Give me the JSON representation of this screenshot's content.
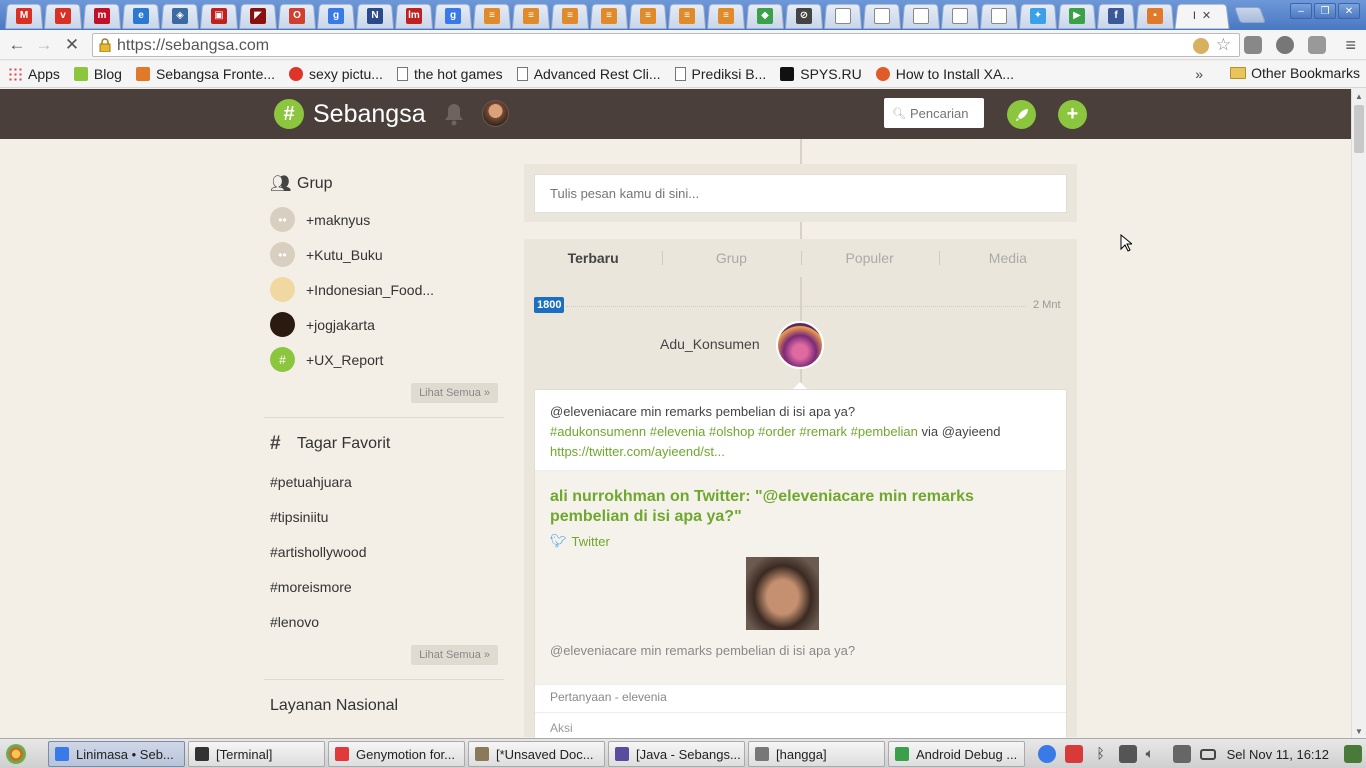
{
  "browser": {
    "tabs": [
      {
        "icon": "gmail-icon",
        "color": "#d93025",
        "glyph": "M"
      },
      {
        "icon": "vivo-icon",
        "color": "#d93025",
        "glyph": "v"
      },
      {
        "icon": "m-icon",
        "color": "#c0102a",
        "glyph": "m"
      },
      {
        "icon": "ie-icon",
        "color": "#2a78d0",
        "glyph": "e"
      },
      {
        "icon": "fox-icon",
        "color": "#3a6aa0",
        "glyph": "◈"
      },
      {
        "icon": "red-icon",
        "color": "#c02020",
        "glyph": "▣"
      },
      {
        "icon": "dark-red-icon",
        "color": "#8a1010",
        "glyph": "◤"
      },
      {
        "icon": "opera-icon",
        "color": "#d04030",
        "glyph": "O"
      },
      {
        "icon": "google-icon",
        "color": "#3a7ae8",
        "glyph": "g"
      },
      {
        "icon": "news-icon",
        "color": "#2a4a8a",
        "glyph": "N"
      },
      {
        "icon": "lm-icon",
        "color": "#c02020",
        "glyph": "lm"
      },
      {
        "icon": "google-icon",
        "color": "#3a7ae8",
        "glyph": "g"
      },
      {
        "icon": "stack-icon",
        "color": "#e08a2a",
        "glyph": "≡"
      },
      {
        "icon": "stack-icon",
        "color": "#e08a2a",
        "glyph": "≡"
      },
      {
        "icon": "stack-icon",
        "color": "#e08a2a",
        "glyph": "≡"
      },
      {
        "icon": "stack-icon",
        "color": "#e08a2a",
        "glyph": "≡"
      },
      {
        "icon": "stack-icon",
        "color": "#e08a2a",
        "glyph": "≡"
      },
      {
        "icon": "stack-icon",
        "color": "#e08a2a",
        "glyph": "≡"
      },
      {
        "icon": "stack-icon",
        "color": "#e08a2a",
        "glyph": "≡"
      },
      {
        "icon": "maps-icon",
        "color": "#3aa04a",
        "glyph": "◆"
      },
      {
        "icon": "compass-icon",
        "color": "#444444",
        "glyph": "⊘"
      },
      {
        "icon": "doc-icon",
        "color": "#ffffff",
        "glyph": ""
      },
      {
        "icon": "doc-icon",
        "color": "#ffffff",
        "glyph": ""
      },
      {
        "icon": "doc-icon",
        "color": "#ffffff",
        "glyph": ""
      },
      {
        "icon": "doc-icon",
        "color": "#ffffff",
        "glyph": ""
      },
      {
        "icon": "doc-icon",
        "color": "#ffffff",
        "glyph": ""
      },
      {
        "icon": "twitter-icon",
        "color": "#3aa0e8",
        "glyph": "✦"
      },
      {
        "icon": "play-icon",
        "color": "#3aa04a",
        "glyph": "▶"
      },
      {
        "icon": "facebook-icon",
        "color": "#3b5998",
        "glyph": "f"
      },
      {
        "icon": "flag-icon",
        "color": "#e07a2a",
        "glyph": "▪"
      }
    ],
    "active_tab_label": "I",
    "url": "https://sebangsa.com",
    "bookmarks": [
      {
        "label": "Apps",
        "icon": "apps-grid-icon",
        "color": ""
      },
      {
        "label": "Blog",
        "icon": "blog-icon",
        "color": "#8cc63f"
      },
      {
        "label": "Sebangsa Fronte...",
        "icon": "sebangsa-icon",
        "color": "#e07a2a"
      },
      {
        "label": "sexy pictu...",
        "icon": "heart-icon",
        "color": "#e0332a"
      },
      {
        "label": "the hot games",
        "icon": "page-icon",
        "color": ""
      },
      {
        "label": "Advanced Rest Cli...",
        "icon": "page-icon",
        "color": ""
      },
      {
        "label": "Prediksi B...",
        "icon": "page-icon",
        "color": ""
      },
      {
        "label": "SPYS.RU",
        "icon": "spys-icon",
        "color": "#111111"
      },
      {
        "label": "How to Install XA...",
        "icon": "upload-icon",
        "color": "#e05a2a"
      }
    ],
    "overflow_label": "»",
    "other_bookmarks": "Other Bookmarks"
  },
  "header": {
    "brand": "Sebangsa",
    "search_placeholder": "Pencarian",
    "accent": "#8cc63f",
    "bg": "#4a3f3a"
  },
  "sidebar": {
    "groups_title": "Grup",
    "groups": [
      {
        "name": "+maknyus",
        "color": "#d8cfc0"
      },
      {
        "name": "+Kutu_Buku",
        "color": "#d8cfc0"
      },
      {
        "name": "+Indonesian_Food...",
        "color": "#f0d8a0"
      },
      {
        "name": "+jogjakarta",
        "color": "#2a1a10"
      },
      {
        "name": "+UX_Report",
        "color": "#8cc63f"
      }
    ],
    "groups_more": "Lihat Semua »",
    "tags_title": "Tagar Favorit",
    "tags": [
      "#petuahjuara",
      "#tipsiniitu",
      "#artishollywood",
      "#moreismore",
      "#lenovo"
    ],
    "tags_more": "Lihat Semua »",
    "national_title": "Layanan Nasional"
  },
  "feed": {
    "compose_placeholder": "Tulis pesan kamu di sini...",
    "tabs": [
      "Terbaru",
      "Grup",
      "Populer",
      "Media"
    ],
    "count": "1800",
    "time_ago": "2 Mnt",
    "author": "Adu_Konsumen",
    "post": {
      "text_plain": "@eleveniacare min remarks pembelian di isi apa ya?",
      "hashtags": "#adukonsumenn #elevenia #olshop #order #remark #pembelian",
      "via": " via @ayieend",
      "link": "https://twitter.com/ayieend/st...",
      "card_title": "ali nurrokhman on Twitter: \"@eleveniacare min remarks pembelian di isi apa ya?\"",
      "card_source": "Twitter",
      "card_desc": "@eleveniacare min remarks pembelian di isi apa ya?",
      "meta": "Pertanyaan - elevenia",
      "actions": "Aksi"
    }
  },
  "taskbar": {
    "tasks": [
      {
        "label": "Linimasa • Seb...",
        "icon": "chrome-icon",
        "color": "#3a7ae8"
      },
      {
        "label": "[Terminal]",
        "icon": "terminal-icon",
        "color": "#333333"
      },
      {
        "label": "Genymotion for...",
        "icon": "genymotion-icon",
        "color": "#e03a3a"
      },
      {
        "label": "[*Unsaved Doc...",
        "icon": "editor-icon",
        "color": "#8a7a5a"
      },
      {
        "label": "[Java - Sebangs...",
        "icon": "eclipse-icon",
        "color": "#5a4aa0"
      },
      {
        "label": "[hangga]",
        "icon": "home-folder-icon",
        "color": "#777777"
      },
      {
        "label": "Android Debug ...",
        "icon": "android-icon",
        "color": "#3aa04a"
      }
    ],
    "clock": "Sel Nov 11, 16:12"
  }
}
